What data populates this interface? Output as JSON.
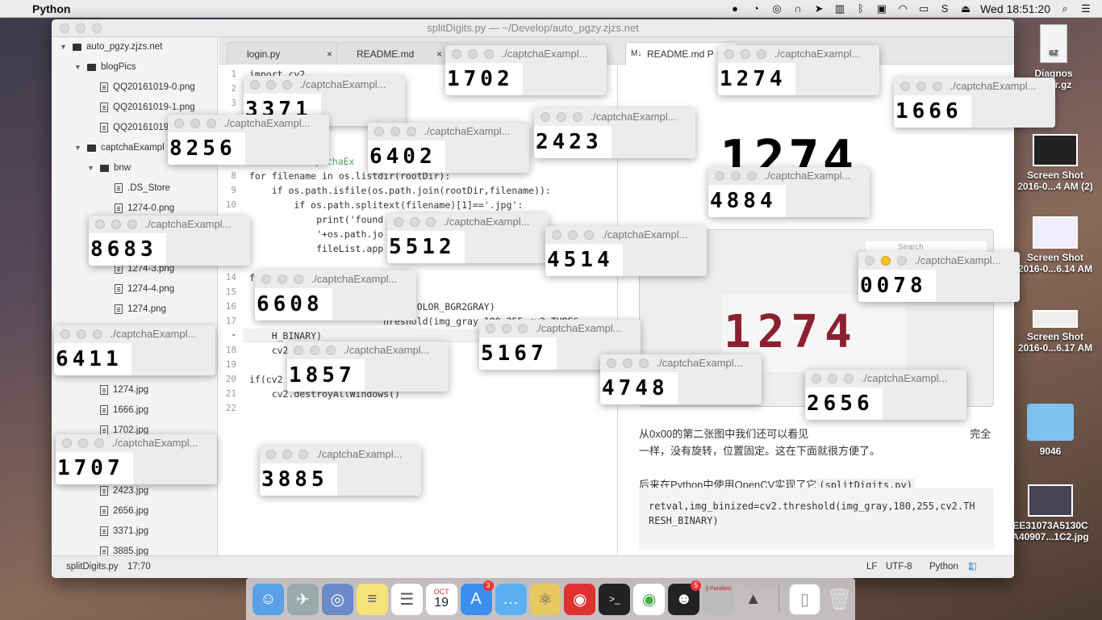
{
  "menubar": {
    "app_name": "Python",
    "clock": "Wed 18:51:20",
    "icons": [
      "apple-icon",
      "qq-icon",
      "rss-icon",
      "vpn-icon",
      "headphones-icon",
      "send-icon",
      "battery-pack-icon",
      "bluetooth-icon",
      "lock-icon",
      "wifi-icon",
      "battery-icon",
      "s-app-icon",
      "eject-icon",
      "search-icon",
      "list-icon"
    ]
  },
  "editor": {
    "title": "splitDigits.py — ~/Develop/auto_pgzy.zjzs.net",
    "tabs": [
      {
        "label": "login.py",
        "close": "×"
      },
      {
        "label": "README.md",
        "close": "×"
      },
      {
        "label": "README.md P",
        "close": ""
      }
    ],
    "tree": [
      {
        "label": "auto_pgzy.zjzs.net",
        "type": "folder",
        "expanded": true
      },
      {
        "label": "blogPics",
        "type": "folder",
        "expanded": true
      },
      {
        "label": "QQ20161019-0.png",
        "type": "file"
      },
      {
        "label": "QQ20161019-1.png",
        "type": "file"
      },
      {
        "label": "QQ20161019",
        "type": "file"
      },
      {
        "label": "captchaExampl",
        "type": "folder",
        "expanded": true
      },
      {
        "label": "bnw",
        "type": "folder",
        "expanded": true
      },
      {
        "label": ".DS_Store",
        "type": "file"
      },
      {
        "label": "1274-0.png",
        "type": "file"
      },
      {
        "label": "1274-3.png",
        "type": "file"
      },
      {
        "label": "1274-4.png",
        "type": "file"
      },
      {
        "label": "1274.png",
        "type": "file"
      },
      {
        "label": "1274.jpg",
        "type": "file"
      },
      {
        "label": "1666.jpg",
        "type": "file"
      },
      {
        "label": "1702.jpg",
        "type": "file"
      },
      {
        "label": "2423.jpg",
        "type": "file"
      },
      {
        "label": "2656.jpg",
        "type": "file"
      },
      {
        "label": "3371.jpg",
        "type": "file"
      },
      {
        "label": "3885.jpg",
        "type": "file"
      }
    ],
    "code_lines": [
      {
        "n": "1",
        "t": "import cv2"
      },
      {
        "n": "2",
        "t": ""
      },
      {
        "n": "3",
        "t": ""
      },
      {
        "n": "8",
        "t": "for filename in os.listdir(rootDir):"
      },
      {
        "n": "9",
        "t": "    if os.path.isfile(os.path.join(rootDir,filename)):"
      },
      {
        "n": "10",
        "t": "        if os.path.splitext(filename)[1]=='.jpg':"
      },
      {
        "n": "",
        "t": "            print('found"
      },
      {
        "n": "",
        "t": "            '+os.path.jo"
      },
      {
        "n": "",
        "t": "            fileList.app"
      },
      {
        "n": "14",
        "t": "f"
      },
      {
        "n": "15",
        "t": ""
      },
      {
        "n": "16",
        "t": "                        ,cv2.COLOR_BGR2GRAY)"
      },
      {
        "n": "17",
        "t": "                        hreshold(img_gray,180,255,cv2.THRES"
      },
      {
        "n": "•",
        "t": "    H_BINARY)"
      },
      {
        "n": "18",
        "t": "    cv2                                        d)"
      },
      {
        "n": "19",
        "t": ""
      },
      {
        "n": "20",
        "t": "if(cv2"
      },
      {
        "n": "21",
        "t": "    cv2.destroyAllWindows()"
      },
      {
        "n": "22",
        "t": ""
      }
    ],
    "code_fragment_left": "ptchaEx",
    "status": {
      "file": "splitDigits.py",
      "cursor": "17:70",
      "eol": "LF",
      "encoding": "UTF-8",
      "grammar": "Python",
      "update": "1 update"
    }
  },
  "preview": {
    "para1": "从0x00的第二张图中我们还可以看见",
    "para1_end": "完全",
    "para1_line2": "一样，没有旋转，位置固定。这在下面就很方便了。",
    "para2": "后来在Python中使用OpenCV实现了它",
    "para2_code": "(splitDigits.py)",
    "code_block_line1": "retval,img_binized=cv2.threshold(img_gray,180,255,cv2.TH",
    "code_block_line2": "RESH_BINARY)",
    "big_digits_bw": "1274",
    "big_digits_color": "1274",
    "search_placeholder": "Search"
  },
  "captcha_windows": [
    {
      "title": "./captchaExampl...",
      "digits": "1702"
    },
    {
      "title": "./captchaExampl...",
      "digits": "1274"
    },
    {
      "title": "./captchaExampl...",
      "digits": "1666"
    },
    {
      "title": "./captchaExampl...",
      "digits": "3371"
    },
    {
      "title": "./captchaExampl...",
      "digits": "8256"
    },
    {
      "title": "./captchaExampl...",
      "digits": "6402"
    },
    {
      "title": "./captchaExampl...",
      "digits": "2423"
    },
    {
      "title": "./captchaExampl...",
      "digits": "4884"
    },
    {
      "title": "./captchaExampl...",
      "digits": "8683"
    },
    {
      "title": "./captchaExampl...",
      "digits": "5512"
    },
    {
      "title": "./captchaExampl...",
      "digits": "4514"
    },
    {
      "title": "./captchaExampl...",
      "digits": "0078"
    },
    {
      "title": "./captchaExampl...",
      "digits": "6608"
    },
    {
      "title": "./captchaExampl...",
      "digits": "6411"
    },
    {
      "title": "./captchaExampl...",
      "digits": "5167"
    },
    {
      "title": "./captchaExampl...",
      "digits": "1857"
    },
    {
      "title": "./captchaExampl...",
      "digits": "4748"
    },
    {
      "title": "./captchaExampl...",
      "digits": "2656"
    },
    {
      "title": "./captchaExampl...",
      "digits": "1707"
    },
    {
      "title": "./captchaExampl...",
      "digits": "3885"
    }
  ],
  "desktop": [
    {
      "label": "Diagnos",
      "label2": ".0.tar.gz"
    },
    {
      "label": "Screen Shot",
      "label2": "2016-0...4 AM (2)"
    },
    {
      "label": "Screen Shot",
      "label2": "2016-0...6.14 AM"
    },
    {
      "label": "Screen Shot",
      "label2": "2016-0...6.17 AM"
    },
    {
      "label": "9046",
      "label2": ""
    },
    {
      "label": "EE31073A5130C",
      "label2": "A40907...1C2.jpg"
    }
  ],
  "dock": {
    "items": [
      "finder-icon",
      "launchpad-icon",
      "network-icon",
      "notes-icon",
      "reminders-icon",
      "calendar-icon",
      "app-store-icon",
      "messages-icon",
      "atom-icon",
      "netease-music-icon",
      "terminal-icon",
      "chrome-icon",
      "qq-icon",
      "parallels-icon",
      "rocket-icon",
      "document-icon",
      "trash-icon"
    ],
    "calendar_month": "OCT",
    "calendar_day": "19",
    "app_store_badge": "3",
    "qq_badge": "5",
    "parallels_label": "|| Parallels"
  }
}
